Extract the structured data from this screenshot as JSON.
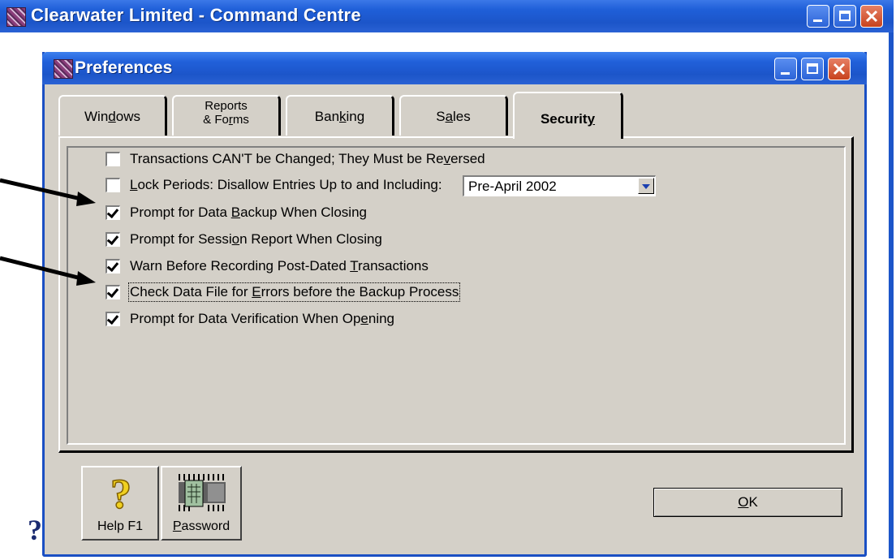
{
  "app": {
    "title": "Clearwater Limited - Command Centre"
  },
  "dialog": {
    "title": "Preferences"
  },
  "tabs": [
    {
      "label_line1": "Windows",
      "label_line2": ""
    },
    {
      "label_line1": "Reports",
      "label_line2": "& Forms"
    },
    {
      "label_line1": "Banking",
      "label_line2": ""
    },
    {
      "label_line1": "Sales",
      "label_line2": ""
    },
    {
      "label_line1": "Security",
      "label_line2": ""
    }
  ],
  "active_tab": "Security",
  "options": [
    {
      "label": "Transactions CAN'T be Changed; They Must be Reversed",
      "checked": false
    },
    {
      "label": "Lock Periods: Disallow Entries Up to and Including:",
      "checked": false
    },
    {
      "label": "Prompt for Data Backup When Closing",
      "checked": true
    },
    {
      "label": "Prompt for Session Report When Closing",
      "checked": true
    },
    {
      "label": "Warn Before Recording Post-Dated Transactions",
      "checked": true
    },
    {
      "label": "Check Data File for Errors before the Backup Process",
      "checked": true
    },
    {
      "label": "Prompt for Data Verification When Opening",
      "checked": true
    }
  ],
  "lock_period": {
    "selected": "Pre-April 2002"
  },
  "buttons": {
    "help": "Help F1",
    "password": "Password",
    "ok": "OK"
  },
  "help_glyph": "?"
}
